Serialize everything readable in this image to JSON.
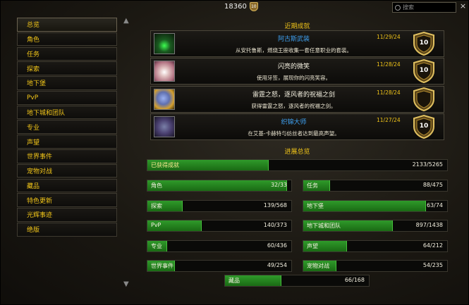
{
  "header": {
    "points": "18360",
    "points_badge": "10"
  },
  "search": {
    "placeholder": "搜索",
    "close": "×"
  },
  "sidebar": {
    "items": [
      {
        "label": "总览"
      },
      {
        "label": "角色"
      },
      {
        "label": "任务"
      },
      {
        "label": "探索"
      },
      {
        "label": "地下堡"
      },
      {
        "label": "PvP"
      },
      {
        "label": "地下城和团队"
      },
      {
        "label": "专业"
      },
      {
        "label": "声望"
      },
      {
        "label": "世界事件"
      },
      {
        "label": "宠物对战"
      },
      {
        "label": "藏品"
      },
      {
        "label": "特色更新"
      },
      {
        "label": "光辉事迹"
      },
      {
        "label": "绝版"
      }
    ]
  },
  "recent": {
    "title": "近期成就",
    "items": [
      {
        "name": "阿古斯武装",
        "desc": "从安托鲁斯，燃烧王座收集一套任意职业的套装。",
        "date": "11/29/24",
        "points": "10",
        "color": "#3ea0f0"
      },
      {
        "name": "闪亮的微笑",
        "desc": "使用牙签，展现你的闪亮笑容。",
        "date": "11/28/24",
        "points": "10",
        "color": "#f4f0e0"
      },
      {
        "name": "雷霆之怒，逐风者的祝福之剑",
        "desc": "获得雷霆之怒，逐风者的祝福之剑。",
        "date": "11/28/24",
        "points": "",
        "color": "#f4f0e0"
      },
      {
        "name": "织锦大师",
        "desc": "在艾基-卡赫特与纺丝者达到最高声望。",
        "date": "11/27/24",
        "points": "10",
        "color": "#3ea0f0"
      }
    ]
  },
  "progress": {
    "title": "进展总览",
    "overall": {
      "label": "已获得成就",
      "value": "2133/5265",
      "fraction": 0.405
    },
    "rows": [
      {
        "label": "角色",
        "value": "32/33",
        "fraction": 0.97
      },
      {
        "label": "任务",
        "value": "88/475",
        "fraction": 0.185
      },
      {
        "label": "探索",
        "value": "139/568",
        "fraction": 0.245
      },
      {
        "label": "地下堡",
        "value": "63/74",
        "fraction": 0.851
      },
      {
        "label": "PvP",
        "value": "140/373",
        "fraction": 0.375
      },
      {
        "label": "地下城和团队",
        "value": "897/1438",
        "fraction": 0.624
      },
      {
        "label": "专业",
        "value": "60/436",
        "fraction": 0.138
      },
      {
        "label": "声望",
        "value": "64/212",
        "fraction": 0.302
      },
      {
        "label": "世界事件",
        "value": "49/254",
        "fraction": 0.193
      },
      {
        "label": "宠物对战",
        "value": "54/235",
        "fraction": 0.23
      },
      {
        "label": "藏品",
        "value": "66/168",
        "fraction": 0.393
      }
    ]
  },
  "colors": {
    "accent": "#f0c419",
    "bar": "#2f9a2a",
    "link": "#3ea0f0"
  }
}
